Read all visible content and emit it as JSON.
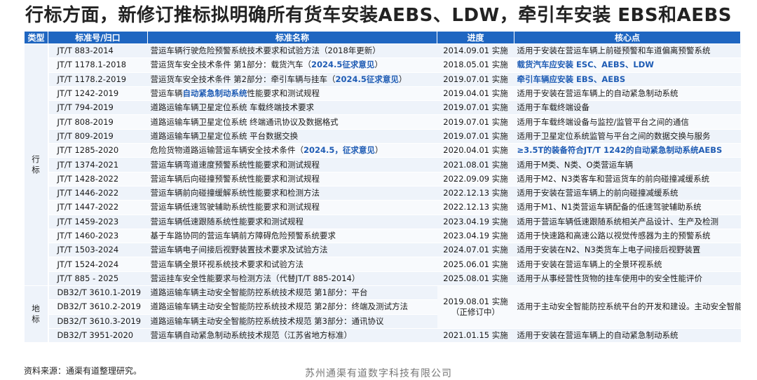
{
  "title": "行标方面，新修订推标拟明确所有货车安装AEBS、LDW，牵引车安装 EBS和AEBS",
  "headers": {
    "type": "类型",
    "code": "标准号/归口",
    "name": "标准名称",
    "progress": "进度",
    "key": "核心点"
  },
  "groups": {
    "industry": "行\n标",
    "local": "地\n标"
  },
  "rows": [
    {
      "code": "JT/T  883-2014",
      "name": "营运车辆行驶危险预警系统技术要求和试验方法（2018年更新）",
      "progress": "2014.09.01 实施",
      "key": "适用于安装在营运车辆上前碰预警和车道偏离预警系统"
    },
    {
      "code": "JT/T 1178.1-2018",
      "name_a": "营运货车安全技术条件 第1部分：载货汽车（",
      "name_hl": "2024.5征求意见",
      "name_b": "）",
      "progress": "2018.05.01 实施",
      "key_hl": "载货汽车应安装 ESC、AEBS、LDW"
    },
    {
      "code": "JT/T 1178.2-2019",
      "name_a": "营运货车安全技术条件 第2部分：牵引车辆与挂车（",
      "name_hl": "2024.5征求意见",
      "name_b": "）",
      "progress": "2019.07.01 实施",
      "key_hl": "牵引车辆应安装 EBS、AEBS"
    },
    {
      "code": "JT/T 1242-2019",
      "name_a": "营运车辆",
      "name_hl": "自动紧急制动系统",
      "name_b": "性能要求和测试规程",
      "progress": "2019.04.01 实施",
      "key": "适用于安装在营运车辆上的自动紧急制动系统"
    },
    {
      "code": "JT/T 794-2019",
      "name": "道路运输车辆卫星定位系统  车载终端技术要求",
      "progress": "2019.07.01 实施",
      "key": "适用于车载终端设备"
    },
    {
      "code": "JT/T 808-2019",
      "name": "道路运输车辆卫星定位系统  终端通讯协议及数据格式",
      "progress": "2019.07.01 实施",
      "key": "适用于车载终端设备与监控/监管平台之间的通信"
    },
    {
      "code": "JT/T 809-2019",
      "name": "道路运输车辆卫星定位系统  平台数据交换",
      "progress": "2019.07.01 实施",
      "key": "适用于卫星定位系统监管与平台之间的数据交换与服务"
    },
    {
      "code": "JT/T 1285-2020",
      "name_a": "危险货物道路运输营运车辆安全技术条件（",
      "name_hl": "2024.5，征求意见",
      "name_b": "）",
      "progress": "2020.04.01 实施",
      "key_hl": "≥3.5T的装备符合JT/T 1242的自动紧急制动系统AEBS"
    },
    {
      "code": "JT/T 1374-2021",
      "name": "营运车辆弯道速度预警系统性能要求和测试规程",
      "progress": "2021.08.01 实施",
      "key": "适用于M类、N类、O类营运车辆"
    },
    {
      "code": "JT/T 1428-2022",
      "name": "营运车辆后向碰撞预警系统性能要求和测试规程",
      "progress": "2022.09.09 实施",
      "key": "适用于M2、N3类客车和营运货车的前向碰撞减缓系统"
    },
    {
      "code": "JT/T 1446-2022",
      "name": "营运车辆前向碰撞缓解系统性能要求和检测方法",
      "progress": "2022.12.13 实施",
      "key": "适用于安装在营运车辆上的前向碰撞减缓系统"
    },
    {
      "code": "JT/T 1447-2022",
      "name": "营运车辆低速驾驶辅助系统性能要求和测试规程",
      "progress": "2022.12.13 实施",
      "key": "适用于M1、N1类营运车辆配备的低速驾驶辅助系统"
    },
    {
      "code": "JT/T 1459-2023",
      "name": "营运车辆低速跟随系统性能要求和测试规程",
      "progress": "2023.04.19 实施",
      "key": "适用于营运车辆低速跟随系统相关产品设计、生产及检测"
    },
    {
      "code": "JT/T 1460-2023",
      "name": "基于车路协同的营运车辆前方障碍危险预警系统要求",
      "progress": "2023.04.19 实施",
      "key": "适用于快速路和高速公路以视觉传感器为主的预警系统"
    },
    {
      "code": "JT/T 1503-2024",
      "name": "营运车辆电子间接后视野装置技术要求及试验方法",
      "progress": "2024.07.01 实施",
      "key": "适用于安装在N2、N3类货车上电子间接后视野装置"
    },
    {
      "code": "JT/T 1524-2024",
      "name": "营运车辆全景环视系统技术要求和试验方法",
      "progress": "2025.06.01 实施",
      "key": "适用于安装在营运车辆上的全景环视系统"
    },
    {
      "code": "JT/T  885 - 2025",
      "name": "营运挂车安全性能要求与检测方法（代替JT/T 885-2014）",
      "progress": "2025.08.01 实施",
      "key": "适用于从事经营性货物的挂车使用中的安全性能评价"
    }
  ],
  "local_rows": [
    {
      "code": "DB32/T 3610.1-2019",
      "name": "道路运输车辆主动安全智能防控系统技术规范 第1部分：平台"
    },
    {
      "code": "DB32/T 3610.2-2019",
      "name": "道路运输车辆主动安全智能防控系统技术规范 第2部分：终端及测试方法"
    },
    {
      "code": "DB32/T 3610.3-2019",
      "name": "道路运输车辆主动安全智能防控系统技术规范 第3部分：通讯协议"
    }
  ],
  "local_merged": {
    "progress": "2019.08.01 实施\n（正修订中）",
    "key": "适用于主动安全智能防控系统平台的开发和建设。主动安全智能防控系统是指安装在车辆上，具备行车记录、卫星定位、车载视频监控、驾驶辅助、驾驶员状态监测、盲区监测、全景监控等功能，数显主动安全预警的车载设备"
  },
  "local_last": {
    "code": "DB32/T 3951-2020",
    "name": "营运车辆自动紧急制动系统技术规范（江苏省地方标准）",
    "progress": "2021.01.15 实施",
    "key": "适用于安装在营运车辆上的自动紧急制动系统"
  },
  "footer": {
    "source": "资料来源：通渠有道整理研究。",
    "company": "苏州通渠有道数字科技有限公司"
  }
}
